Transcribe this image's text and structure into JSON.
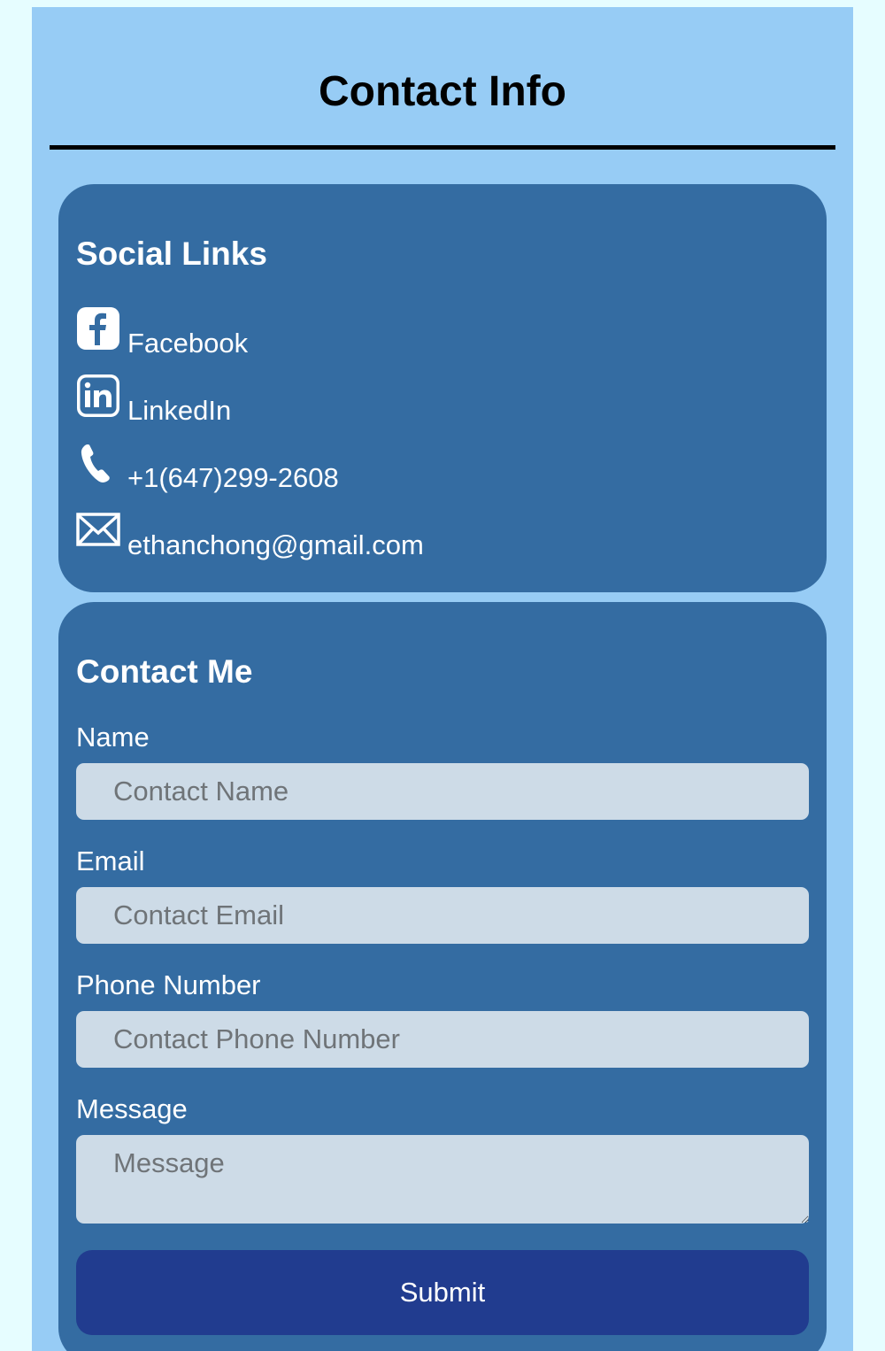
{
  "header": {
    "title": "Contact Info"
  },
  "social": {
    "heading": "Social Links",
    "links": [
      {
        "label": "Facebook",
        "icon": "facebook-icon"
      },
      {
        "label": "LinkedIn",
        "icon": "linkedin-icon"
      },
      {
        "label": "+1(647)299-2608",
        "icon": "phone-icon"
      },
      {
        "label": "ethanchong@gmail.com",
        "icon": "envelope-icon"
      }
    ]
  },
  "contact_form": {
    "heading": "Contact Me",
    "fields": {
      "name": {
        "label": "Name",
        "placeholder": "Contact Name",
        "value": ""
      },
      "email": {
        "label": "Email",
        "placeholder": "Contact Email",
        "value": ""
      },
      "phone": {
        "label": "Phone Number",
        "placeholder": "Contact Phone Number",
        "value": ""
      },
      "message": {
        "label": "Message",
        "placeholder": "Message",
        "value": ""
      }
    },
    "submit_label": "Submit"
  },
  "colors": {
    "page_background": "#e6fdff",
    "column_background": "#97ccf5",
    "card_background": "#346ca2",
    "input_background": "#cddbe7",
    "button_background": "#213c8f",
    "title_text": "#000000",
    "card_text": "#ffffff"
  }
}
